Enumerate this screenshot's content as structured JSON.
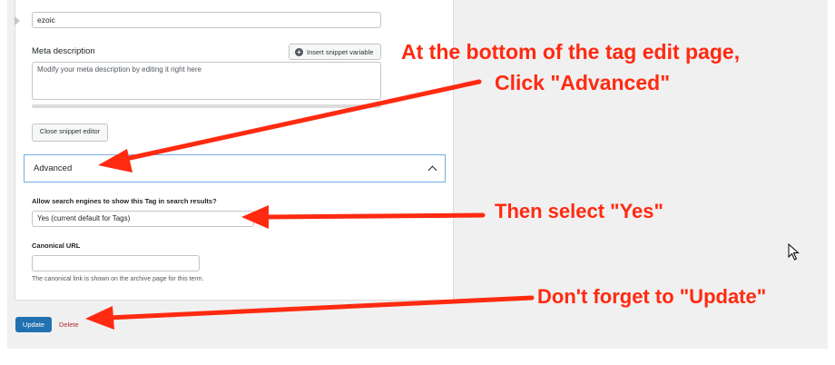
{
  "editor": {
    "slug_value": "ezoic",
    "meta_description_label": "Meta description",
    "insert_snippet_label": "Insert snippet variable",
    "meta_description_placeholder": "Modify your meta description by editing it right here",
    "close_snippet_label": "Close snippet editor"
  },
  "advanced": {
    "header_label": "Advanced",
    "allow_label": "Allow search engines to show this Tag in search results?",
    "allow_value": "Yes (current default for Tags)",
    "canonical_label": "Canonical URL",
    "canonical_help": "The canonical link is shown on the archive page for this term."
  },
  "actions": {
    "update_label": "Update",
    "delete_label": "Delete"
  },
  "annotations": {
    "line1": "At the bottom of the tag edit page,",
    "line2": "Click \"Advanced\"",
    "line3": "Then select \"Yes\"",
    "line4": "Don't forget to \"Update\"",
    "color": "#ff2a10"
  },
  "colors": {
    "primary_button": "#2271b1",
    "delete_link": "#b32d2e",
    "focus_border": "#72aee6"
  }
}
